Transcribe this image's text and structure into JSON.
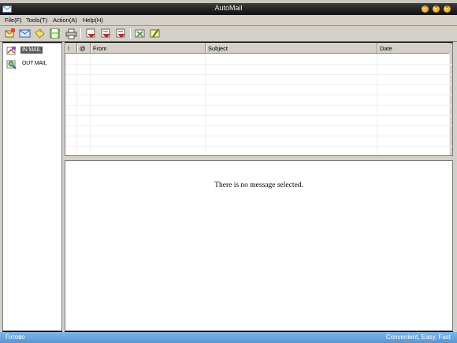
{
  "window": {
    "title": "AutoMail"
  },
  "menu": [
    {
      "label": "File(F)"
    },
    {
      "label": "Tools(T)"
    },
    {
      "label": "Action(A)"
    },
    {
      "label": "Help(H)"
    }
  ],
  "sidebar": {
    "items": [
      {
        "label": "IN MAIL",
        "icon": "inbox-icon",
        "selected": true
      },
      {
        "label": "OUT MAIL",
        "icon": "outbox-icon",
        "selected": false
      }
    ]
  },
  "mail_list": {
    "columns": [
      "!",
      "@",
      "From",
      "Subject",
      "Date"
    ],
    "rows": []
  },
  "preview": {
    "empty_message": "There is no message selected."
  },
  "status": {
    "left": "Готово",
    "right": "Convenient, Easy, Fast"
  },
  "colors": {
    "statusbar": "#6aa3dc",
    "titlebar": "#1e1e1e",
    "chrome": "#d4d0c8",
    "selection": "#5a5a5a"
  }
}
